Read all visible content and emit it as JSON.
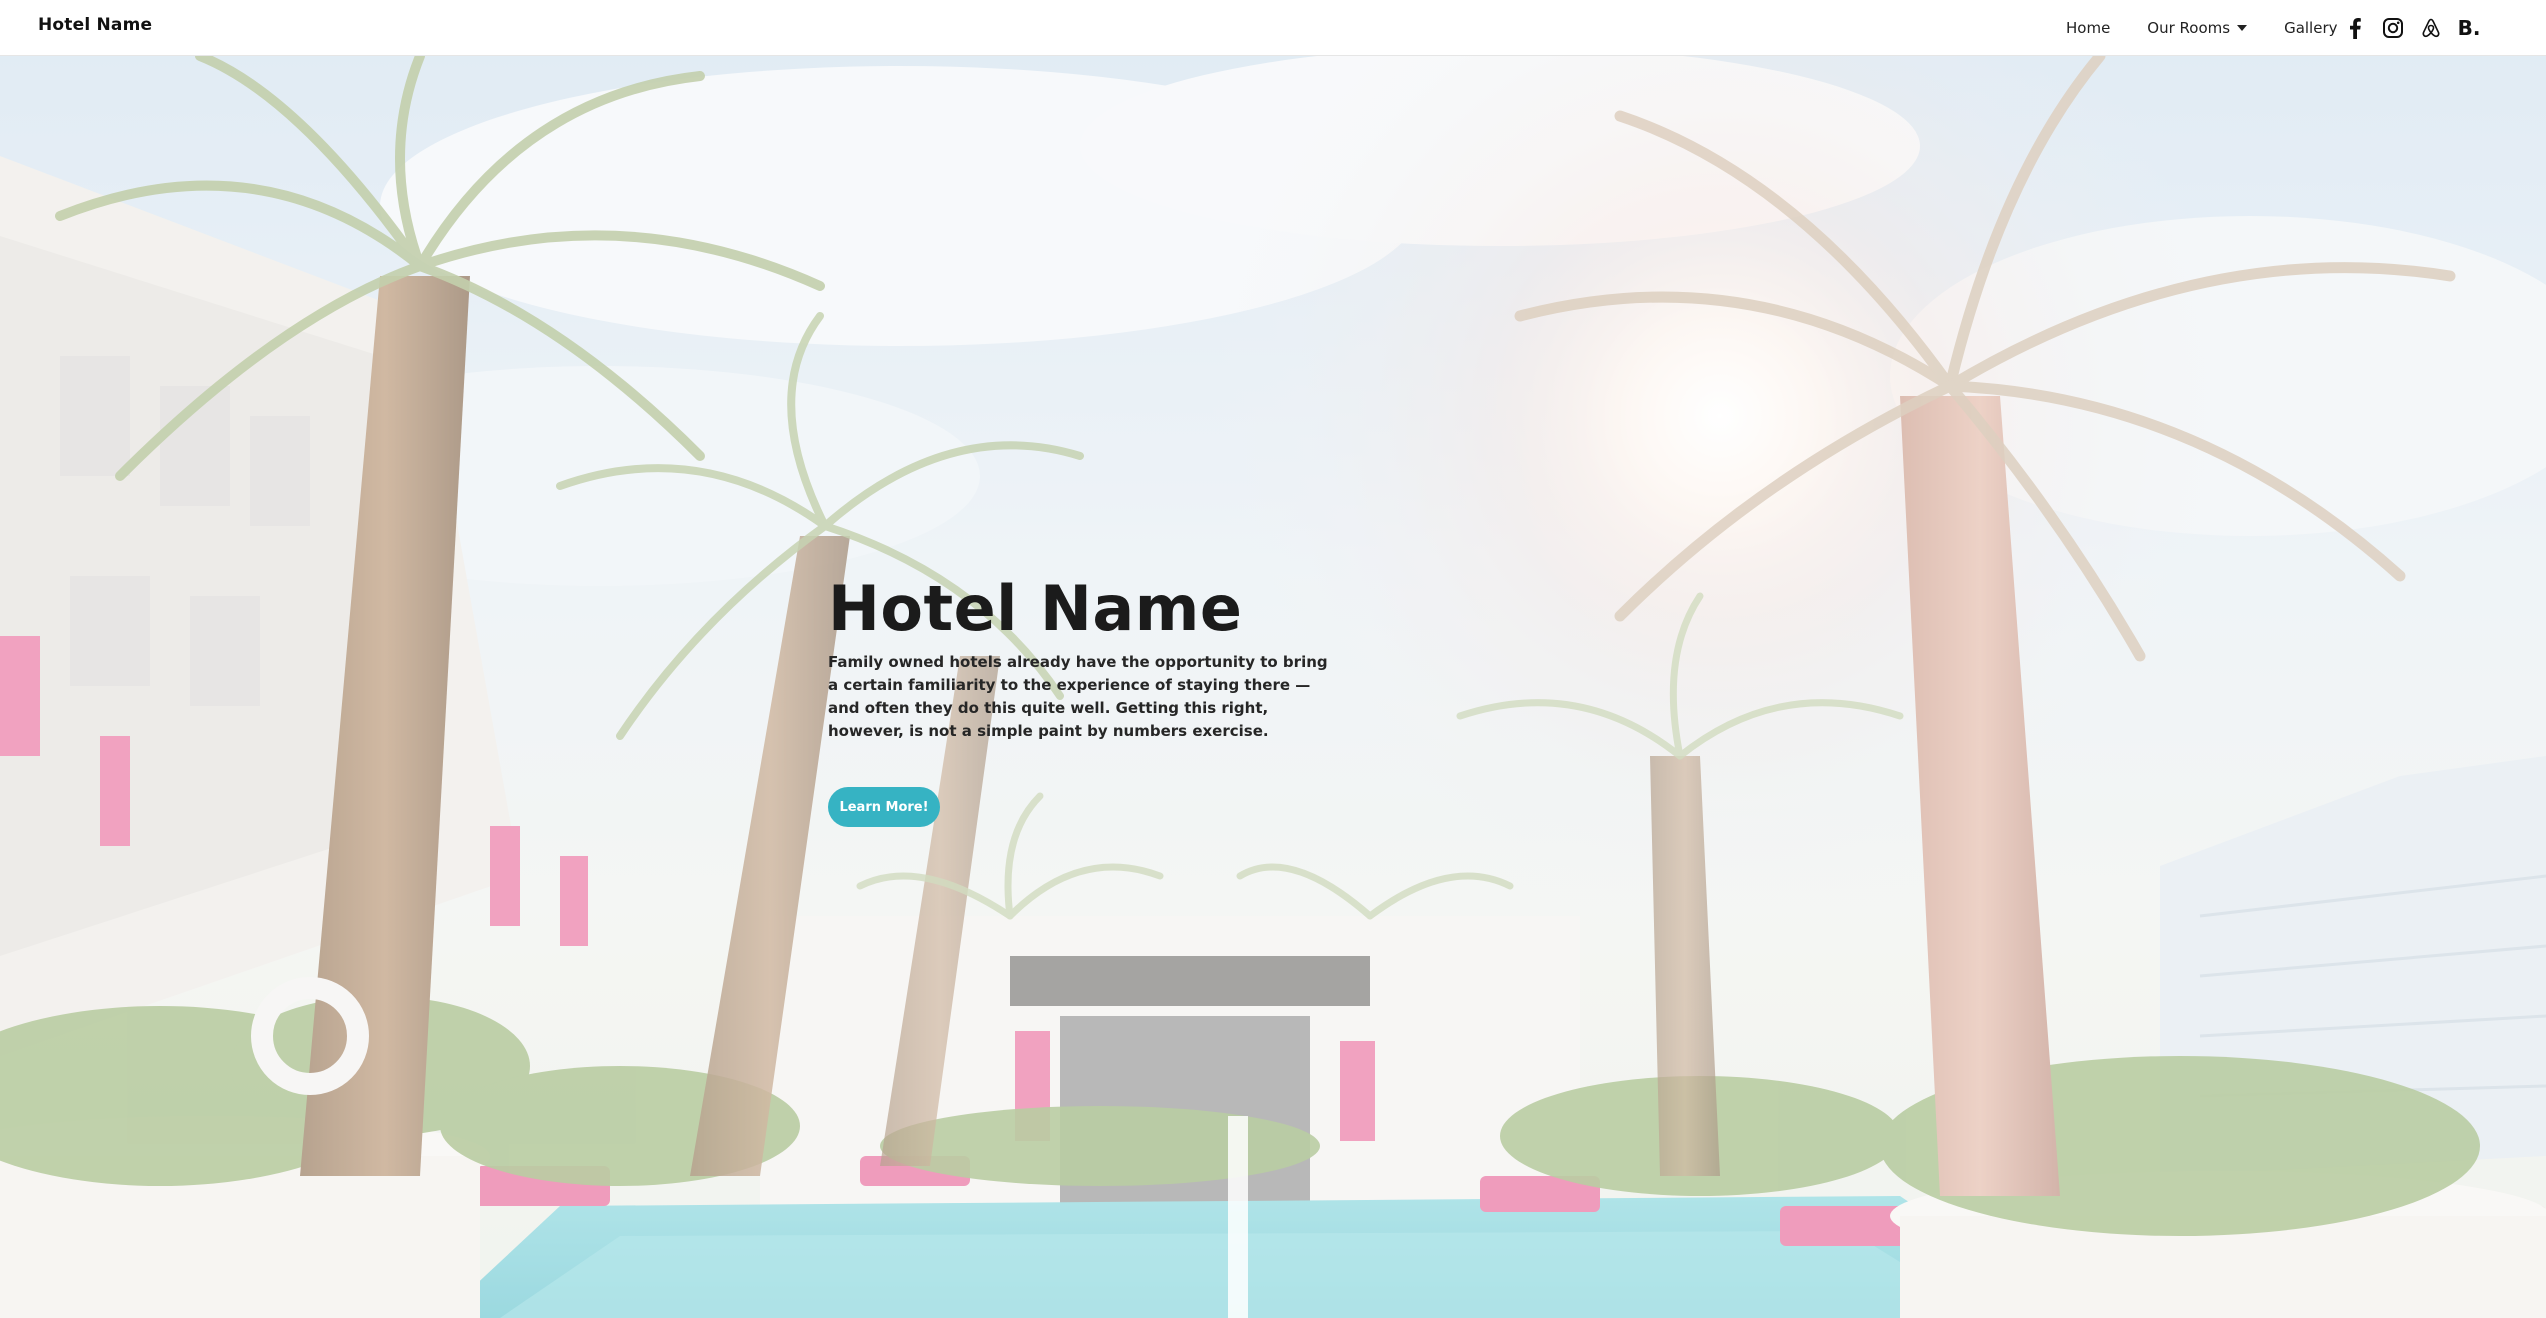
{
  "navbar": {
    "brand": "Hotel Name",
    "links": [
      {
        "label": "Home"
      },
      {
        "label": "Our Rooms",
        "has_dropdown": true
      },
      {
        "label": "Gallery"
      }
    ],
    "socials": [
      {
        "icon": "facebook-icon"
      },
      {
        "icon": "instagram-icon"
      },
      {
        "icon": "airbnb-icon"
      },
      {
        "icon": "booking-icon",
        "text": "B."
      }
    ]
  },
  "hero": {
    "background": "hotel-pool-palm-trees-image",
    "title": "Hotel Name",
    "description": "Family owned hotels already have the opportunity to bring a certain familiarity to the experience of staying there — and often they do this quite well. Getting this right, however, is not a simple paint by numbers exercise.",
    "button_label": "Learn More!"
  },
  "colors": {
    "accent": "#36b3c3",
    "text_dark": "#1b1b1b",
    "navbar_bg": "#ffffff"
  }
}
